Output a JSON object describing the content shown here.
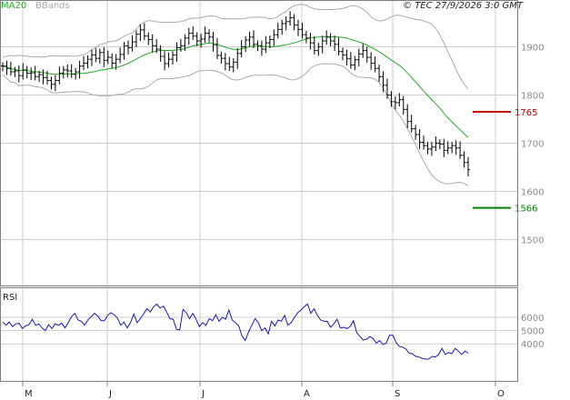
{
  "header": {
    "legend_ma": "MA20",
    "legend_bb": "BBands",
    "copyright": "© TEC 27/9/2026 3:0 GMT"
  },
  "chart_data": [
    {
      "type": "ohlc",
      "title": "",
      "indicators": [
        "MA20",
        "BBands"
      ],
      "y_ticks": [
        1500,
        1600,
        1700,
        1800,
        1900
      ],
      "ylim": [
        1405,
        1995
      ],
      "x_ticks": [
        "M",
        "J",
        "J",
        "A",
        "S",
        "O"
      ],
      "grid": true,
      "levels": [
        {
          "label": "1765",
          "value": 1765,
          "color": "#c00000"
        },
        {
          "label": "1566",
          "value": 1566,
          "color": "#008000"
        }
      ],
      "colors": {
        "price": "#000000",
        "ma": "#22aa22",
        "bbands": "#aaaaaa",
        "rsi": "#1a1aa8",
        "grid": "#cccccc"
      },
      "close": [
        1860,
        1855,
        1848,
        1850,
        1840,
        1852,
        1845,
        1846,
        1838,
        1842,
        1836,
        1830,
        1822,
        1830,
        1845,
        1852,
        1850,
        1843,
        1848,
        1860,
        1866,
        1874,
        1883,
        1876,
        1888,
        1872,
        1878,
        1866,
        1874,
        1884,
        1902,
        1898,
        1910,
        1926,
        1935,
        1922,
        1915,
        1902,
        1895,
        1880,
        1865,
        1874,
        1883,
        1898,
        1902,
        1918,
        1928,
        1922,
        1912,
        1916,
        1928,
        1920,
        1904,
        1882,
        1876,
        1865,
        1858,
        1868,
        1886,
        1900,
        1914,
        1920,
        1905,
        1902,
        1895,
        1908,
        1915,
        1925,
        1936,
        1948,
        1952,
        1960,
        1945,
        1936,
        1925,
        1918,
        1908,
        1892,
        1900,
        1912,
        1920,
        1912,
        1905,
        1890,
        1883,
        1875,
        1862,
        1873,
        1885,
        1892,
        1878,
        1866,
        1855,
        1838,
        1820,
        1800,
        1786,
        1784,
        1790,
        1770,
        1745,
        1730,
        1718,
        1702,
        1695,
        1688,
        1692,
        1700,
        1698,
        1685,
        1690,
        1695,
        1690,
        1675,
        1660,
        1645
      ],
      "rsi": {
        "label": "RSI",
        "y_ticks": [
          4000,
          5000,
          6000
        ],
        "ylim": [
          1200,
          8200
        ],
        "values": [
          5650,
          5400,
          5650,
          5300,
          5500,
          5550,
          5150,
          5350,
          5450,
          5850,
          5400,
          5500,
          5200,
          5000,
          5450,
          5150,
          5500,
          5400,
          5550,
          5200,
          5600,
          6050,
          6300,
          5800,
          5700,
          5400,
          5800,
          6050,
          6300,
          6100,
          5750,
          5750,
          6150,
          6350,
          6200,
          5950,
          5400,
          5650,
          5200,
          5600,
          6250,
          5600,
          5900,
          6250,
          6650,
          6400,
          6800,
          7000,
          6700,
          6850,
          6400,
          5900,
          5850,
          5100,
          5050,
          6600,
          6350,
          5900,
          6300,
          5850,
          5300,
          5600,
          5400,
          5900,
          5750,
          6200,
          5700,
          6000,
          5850,
          6550,
          5800,
          5600,
          5350,
          4600,
          4250,
          4900,
          5400,
          5900,
          5600,
          5000,
          5200,
          4750,
          5700,
          5350,
          5800,
          5700,
          6150,
          5400,
          5600,
          6000,
          6350,
          6550,
          6800,
          7000,
          6300,
          6650,
          6150,
          5800,
          5700,
          5700,
          5250,
          5500,
          5850,
          5200,
          5250,
          5150,
          5300,
          5750,
          4850,
          4550,
          4300,
          4350,
          4550,
          4400,
          4050,
          4250,
          3950,
          4050,
          4650,
          4650,
          4100,
          3800,
          3750,
          3600,
          3300,
          3250,
          3050,
          3000,
          2900,
          2850,
          2850,
          3050,
          3000,
          3200,
          3650,
          3200,
          3350,
          3250,
          3650,
          3450,
          3200,
          3450,
          3300
        ]
      }
    }
  ]
}
